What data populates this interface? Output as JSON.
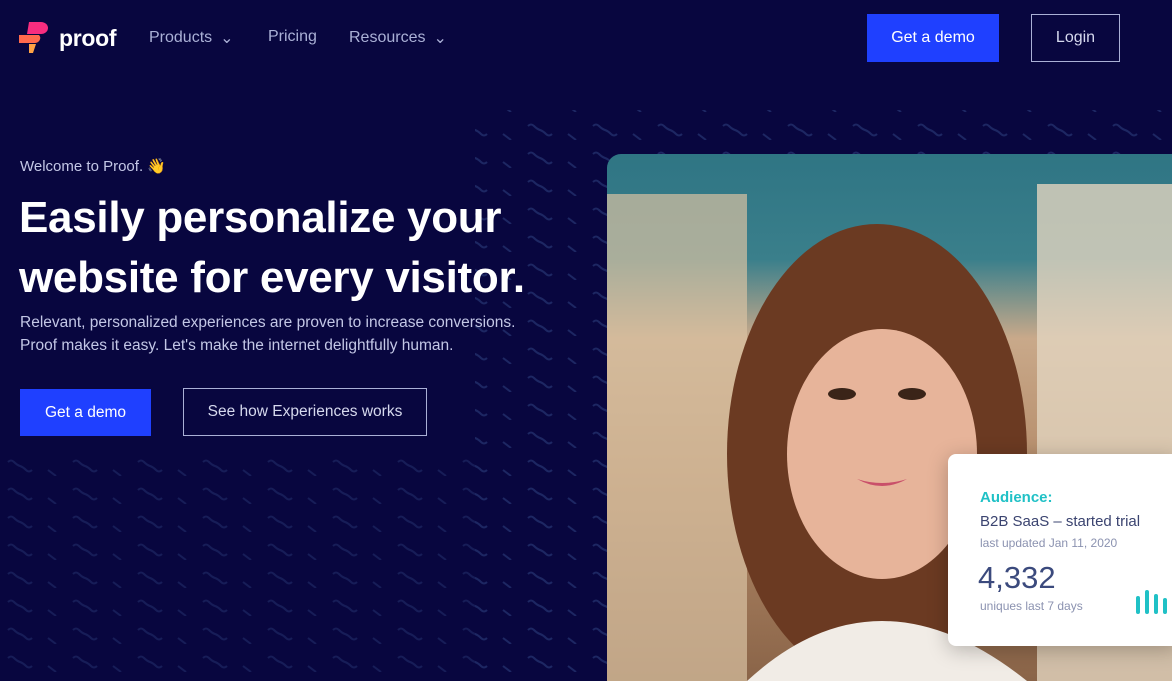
{
  "nav": {
    "brand": "proof",
    "items": [
      {
        "label": "Products",
        "dropdown": true
      },
      {
        "label": "Pricing",
        "dropdown": false
      },
      {
        "label": "Resources",
        "dropdown": true
      }
    ],
    "demo_label": "Get a demo",
    "login_label": "Login"
  },
  "hero": {
    "welcome": "Welcome to Proof. 👋",
    "headline_line1": "Easily personalize your",
    "headline_line2": "website for every visitor.",
    "sub_line1": "Relevant, personalized experiences are proven to increase conversions.",
    "sub_line2": "Proof makes it easy. Let's make the internet delightfully human.",
    "demo_label": "Get a demo",
    "secondary_label": "See how Experiences works"
  },
  "card": {
    "title": "Audience:",
    "segment": "B2B SaaS – started trial",
    "updated": "last updated Jan 11, 2020",
    "count": "4,332",
    "count_label": "uniques last 7 days"
  },
  "colors": {
    "background": "#08063f",
    "accent": "#1f40ff",
    "teal": "#20c1c6"
  }
}
